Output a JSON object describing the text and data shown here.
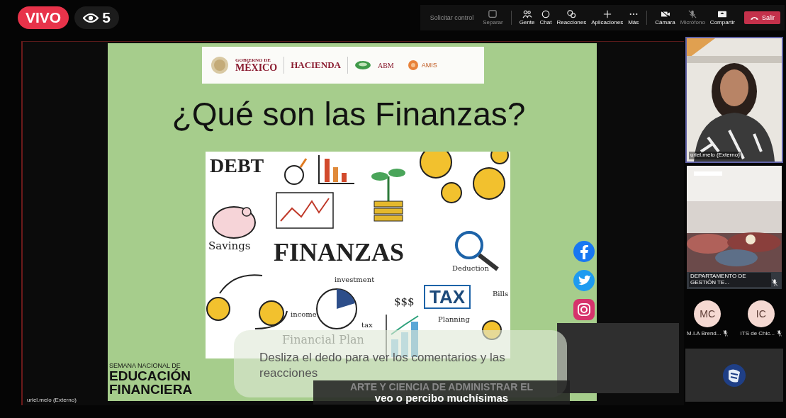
{
  "live_badge": {
    "label": "VIVO"
  },
  "viewer_count": {
    "count": "5"
  },
  "toolbar": [
    {
      "label": "Solicitar control",
      "kind": "text",
      "disabled": true
    },
    {
      "label": "Separar",
      "kind": "icon",
      "disabled": true
    },
    {
      "label": "Gente",
      "kind": "icon",
      "disabled": false
    },
    {
      "label": "Chat",
      "kind": "icon",
      "disabled": false
    },
    {
      "label": "Reacciones",
      "kind": "icon",
      "disabled": false
    },
    {
      "label": "Aplicaciones",
      "kind": "icon",
      "disabled": false
    },
    {
      "label": "Más",
      "kind": "icon",
      "disabled": false
    },
    {
      "label": "Cámara",
      "kind": "icon",
      "disabled": false
    },
    {
      "label": "Micrófono",
      "kind": "icon",
      "disabled": true
    },
    {
      "label": "Compartir",
      "kind": "icon",
      "disabled": false
    },
    {
      "label": "Salir",
      "kind": "leave"
    }
  ],
  "slide": {
    "logos": [
      "GOBIERNO DE",
      "MÉXICO",
      "HACIENDA",
      "ABM",
      "AMIS"
    ],
    "title": "¿Qué son las Finanzas?",
    "illustration_words": [
      "DEBT",
      "Savings",
      "FINANZAS",
      "investment",
      "income",
      "tax",
      "$$$",
      "TAX",
      "Deduction",
      "Bills",
      "Planning",
      "Financial Plan"
    ],
    "footer": [
      "SEMANA NACIONAL DE",
      "EDUCACIÓN",
      "FINANCIERA"
    ]
  },
  "stage_name": "uriel.melo (Externo)",
  "toast": "Desliza el dedo para ver los comentarios y las reacciones",
  "captions": [
    "ARTE Y CIENCIA DE ADMINISTRAR EL",
    "veo o percibo muchísimas"
  ],
  "video_tiles": [
    {
      "name": "uriel.melo (Externo)",
      "selected": true,
      "muted": false,
      "kind": "picture"
    },
    {
      "name": "DEPARTAMENTO DE GESTIÓN TE...",
      "selected": false,
      "muted": true,
      "kind": "picture"
    }
  ],
  "participants": [
    {
      "initials": "MC",
      "name": "M.I.A Brend...",
      "muted": true
    },
    {
      "initials": "IC",
      "name": "ITS de Chic...",
      "muted": true
    }
  ]
}
